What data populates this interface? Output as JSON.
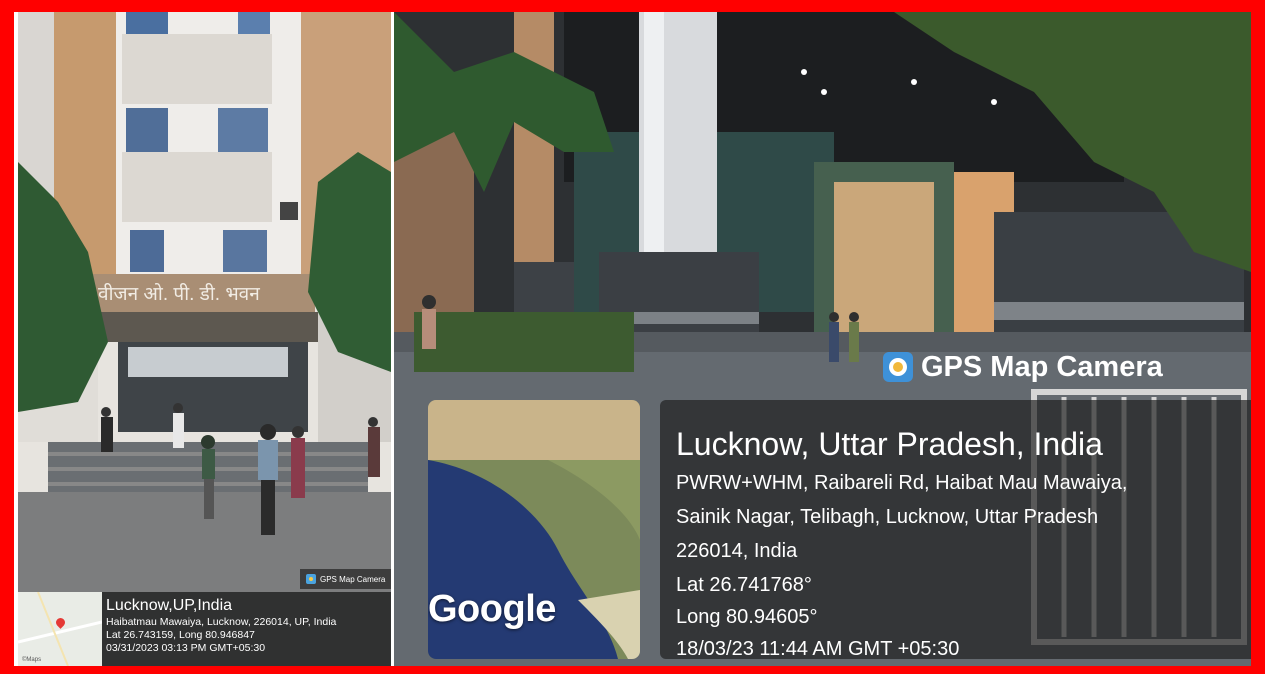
{
  "left_photo": {
    "signage": "वीजन ओ. पी. डी. भवन",
    "badge": "GPS Map Camera",
    "map_attribution": "©Maps",
    "title": "Lucknow,UP,India",
    "address": "Haibatmau Mawaiya, Lucknow, 226014, UP, India",
    "coords": "Lat 26.743159, Long 80.946847",
    "datetime": "03/31/2023 03:13 PM GMT+05:30"
  },
  "right_photo": {
    "badge": "GPS Map Camera",
    "map_logo": "Google",
    "title": "Lucknow, Uttar Pradesh, India",
    "address_lines": [
      "PWRW+WHM, Raibareli Rd, Haibat Mau Mawaiya,",
      "Sainik Nagar, Telibagh, Lucknow, Uttar Pradesh",
      "226014, India"
    ],
    "lat": "Lat 26.741768°",
    "long": "Long 80.94605°",
    "datetime": "18/03/23 11:44 AM GMT +05:30"
  },
  "colors": {
    "frame": "#ff0000",
    "overlay": "#1e1e1e"
  }
}
